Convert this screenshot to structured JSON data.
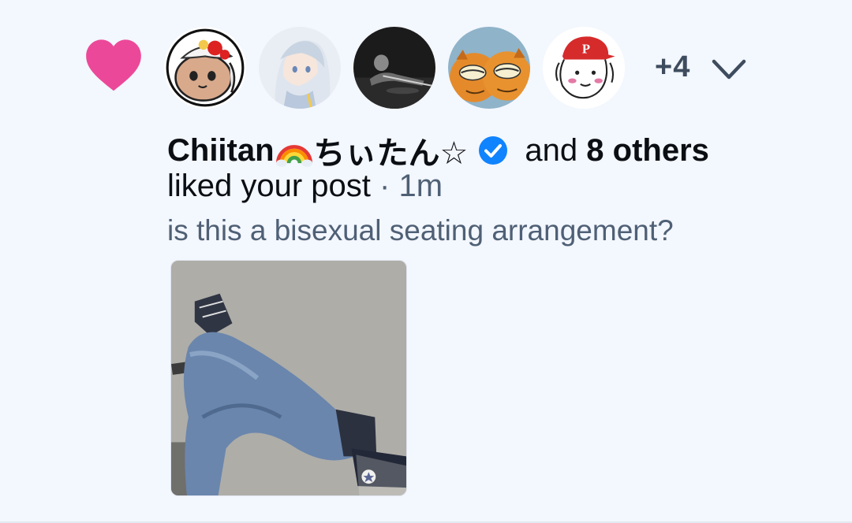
{
  "notification": {
    "type_icon": "heart-icon",
    "accent_color": "#ec4899",
    "avatars": [
      {
        "name": "avatar-chiitan",
        "alt": "Chiitan"
      },
      {
        "name": "avatar-anime-girl",
        "alt": "anime girl"
      },
      {
        "name": "avatar-billiards",
        "alt": "billiards player"
      },
      {
        "name": "avatar-garfield",
        "alt": "Garfield"
      },
      {
        "name": "avatar-doodle-cap",
        "alt": "doodle with red cap"
      }
    ],
    "more_count": "+4",
    "expand_icon": "chevron-down-icon",
    "actor_name": "Chiitan",
    "actor_name_suffix": "ちぃたん☆",
    "verified_icon": "verified-check-icon",
    "and_text": "and",
    "others_text": "8 others",
    "action_text": "liked your post",
    "separator": " · ",
    "time": "1m",
    "post_text": "is this a bisexual seating arrangement?",
    "verified_color": "#1083fe"
  }
}
